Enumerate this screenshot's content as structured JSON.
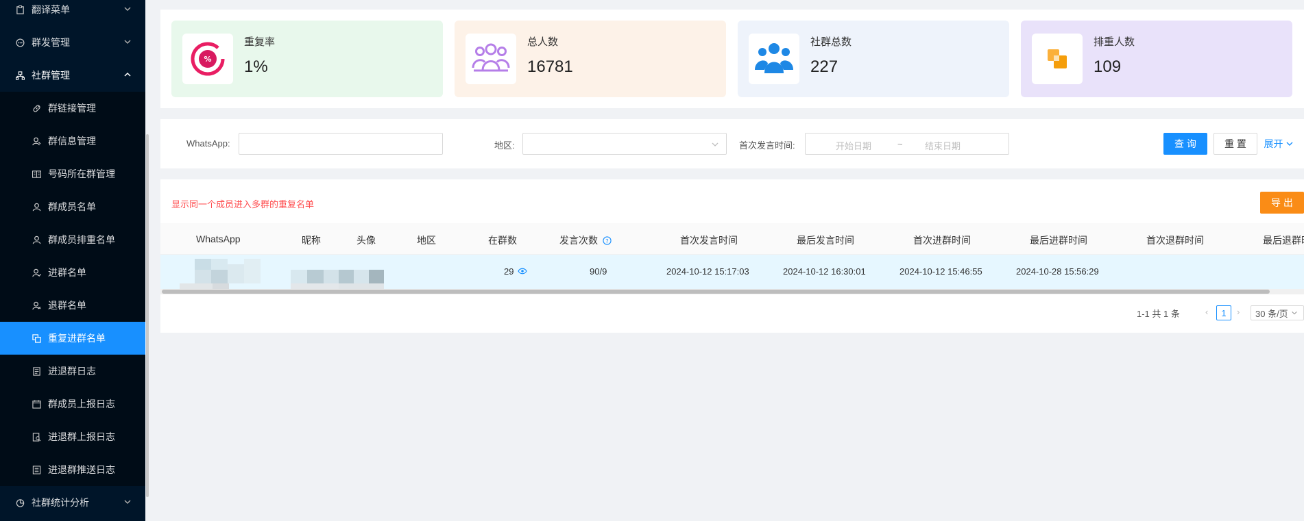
{
  "sidebar": {
    "top_items": [
      {
        "label": "翻译菜单",
        "icon": "clipboard-icon"
      },
      {
        "label": "群发管理",
        "icon": "chat-icon"
      },
      {
        "label": "社群管理",
        "icon": "org-icon"
      }
    ],
    "sub_items": [
      {
        "label": "群链接管理",
        "icon": "link-icon"
      },
      {
        "label": "群信息管理",
        "icon": "user-info-icon"
      },
      {
        "label": "号码所在群管理",
        "icon": "book-icon"
      },
      {
        "label": "群成员名单",
        "icon": "user-icon"
      },
      {
        "label": "群成员排重名单",
        "icon": "user-icon"
      },
      {
        "label": "进群名单",
        "icon": "user-in-icon"
      },
      {
        "label": "退群名单",
        "icon": "user-out-icon"
      },
      {
        "label": "重复进群名单",
        "icon": "copy-icon"
      },
      {
        "label": "进退群日志",
        "icon": "doc-icon"
      },
      {
        "label": "群成员上报日志",
        "icon": "calendar-icon"
      },
      {
        "label": "进退群上报日志",
        "icon": "doc-search-icon"
      },
      {
        "label": "进退群推送日志",
        "icon": "list-icon"
      }
    ],
    "bottom_item": {
      "label": "社群统计分析",
      "icon": "pie-icon"
    }
  },
  "stats": [
    {
      "label": "重复率",
      "value": "1%",
      "bg": "#e8f8ec",
      "icon": "percent-icon"
    },
    {
      "label": "总人数",
      "value": "16781",
      "bg": "#fdf2e8",
      "icon": "people-outline-icon"
    },
    {
      "label": "社群总数",
      "value": "227",
      "bg": "#eef3fb",
      "icon": "people-group-icon"
    },
    {
      "label": "排重人数",
      "value": "109",
      "bg": "#e9e2fa",
      "icon": "dedupe-icon"
    }
  ],
  "filter": {
    "whatsapp_label": "WhatsApp",
    "region_label": "地区",
    "first_msg_label": "首次发言时间",
    "start_placeholder": "开始日期",
    "tilde": "~",
    "end_placeholder": "结束日期",
    "query": "查 询",
    "reset": "重 置",
    "expand": "展开"
  },
  "table": {
    "hint": "显示同一个成员进入多群的重复名单",
    "export": "导 出",
    "columns": [
      "WhatsApp",
      "昵称",
      "头像",
      "地区",
      "在群数",
      "发言次数",
      "首次发言时间",
      "最后发言时间",
      "首次进群时间",
      "最后进群时间",
      "首次退群时间",
      "最后退群时间"
    ],
    "rows": [
      {
        "group_count": "29",
        "msg_count": "90/9",
        "first_msg": "2024-10-12 15:17:03",
        "last_msg": "2024-10-12 16:30:01",
        "first_join": "2024-10-12 15:46:55",
        "last_join": "2024-10-28 15:56:29"
      }
    ]
  },
  "pagination": {
    "summary": "1-1 共 1 条",
    "current": "1",
    "page_size": "30 条/页"
  }
}
